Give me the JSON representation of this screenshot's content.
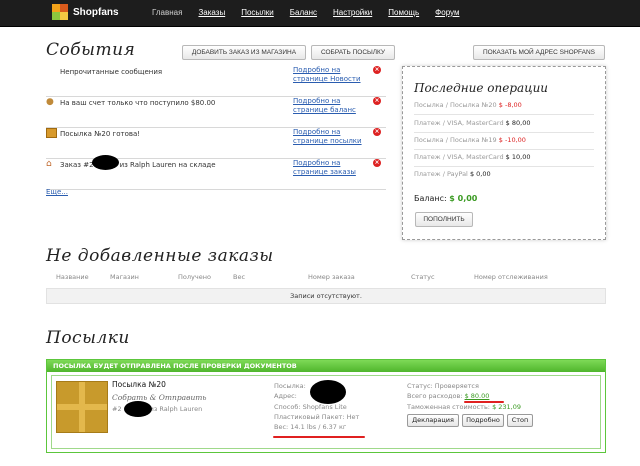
{
  "brand": {
    "name": "Shopfans"
  },
  "nav": [
    "Главная",
    "Заказы",
    "Посылки",
    "Баланс",
    "Настройки",
    "Помощь",
    "Форум"
  ],
  "events": {
    "title": "События",
    "btn_add_order": "ДОБАВИТЬ ЗАКАЗ ИЗ МАГАЗИНА",
    "btn_collect": "СОБРАТЬ ПОСЫЛКУ",
    "btn_address": "ПОКАЗАТЬ МОЙ АДРЕС SHOPFANS",
    "items": [
      {
        "text": "Непрочитанные сообщения",
        "link": "Подробно на странице Новости",
        "icon": "blank-icon"
      },
      {
        "text": "На ваш счет только что поступило $80.00",
        "link": "Подробно на странице баланс",
        "icon": "money-icon"
      },
      {
        "text": "Посылка №20 готова!",
        "link": "Подробно на странице посылки",
        "icon": "package-icon"
      },
      {
        "text_pre": "Заказ #2",
        "text_post": "из Ralph Lauren на складе",
        "link": "Подробно на странице заказы",
        "icon": "warehouse-icon"
      }
    ],
    "more": "Еще..."
  },
  "ops": {
    "title": "Последние операции",
    "rows": [
      {
        "label": "Посылка / Посылка №20",
        "amount": "$ -8,00",
        "type": "neg"
      },
      {
        "label": "Платеж / VISA, MasterCard",
        "amount": "$ 80,00",
        "type": "pos"
      },
      {
        "label": "Посылка / Посылка №19",
        "amount": "$ -10,00",
        "type": "neg"
      },
      {
        "label": "Платеж / VISA, MasterCard",
        "amount": "$ 10,00",
        "type": "pos"
      },
      {
        "label": "Платеж / PayPal",
        "amount": "$ 0,00",
        "type": "pos"
      }
    ],
    "balance_label": "Баланс:",
    "balance_value": "$ 0,00",
    "topup": "ПОПОЛНИТЬ"
  },
  "orders": {
    "title": "Не добавленные заказы",
    "columns": [
      "Название",
      "Магазин",
      "Получено",
      "Вес",
      "Номер заказа",
      "Статус",
      "Номер отслеживания"
    ],
    "empty": "Записи отсутствуют."
  },
  "parcels": {
    "title": "Посылки",
    "banner": "ПОСЫЛКА БУДЕТ ОТПРАВЛЕНА ПОСЛЕ ПРОВЕРКИ ДОКУМЕНТОВ",
    "name": "Посылка №20",
    "subtitle": "Собрать & Отправить",
    "order_pre": "#2",
    "order_post": "из Ralph Lauren",
    "recipient": "Посылка:",
    "address": "Адрес:",
    "method": "Способ: Shopfans Lite",
    "plastic": "Пластиковый Пакет: Нет",
    "weight": "Вес: 14.1 lbs / 6.37 кг",
    "status": "Статус: Проверяется",
    "expenses_label": "Всего расходов:",
    "expenses_value": "$ 80.00",
    "customs_label": "Таможенная стоимость:",
    "customs_value": "$ 231,09",
    "btn_declaration": "Декларация",
    "btn_details": "Подробно",
    "btn_stop": "Стоп"
  }
}
